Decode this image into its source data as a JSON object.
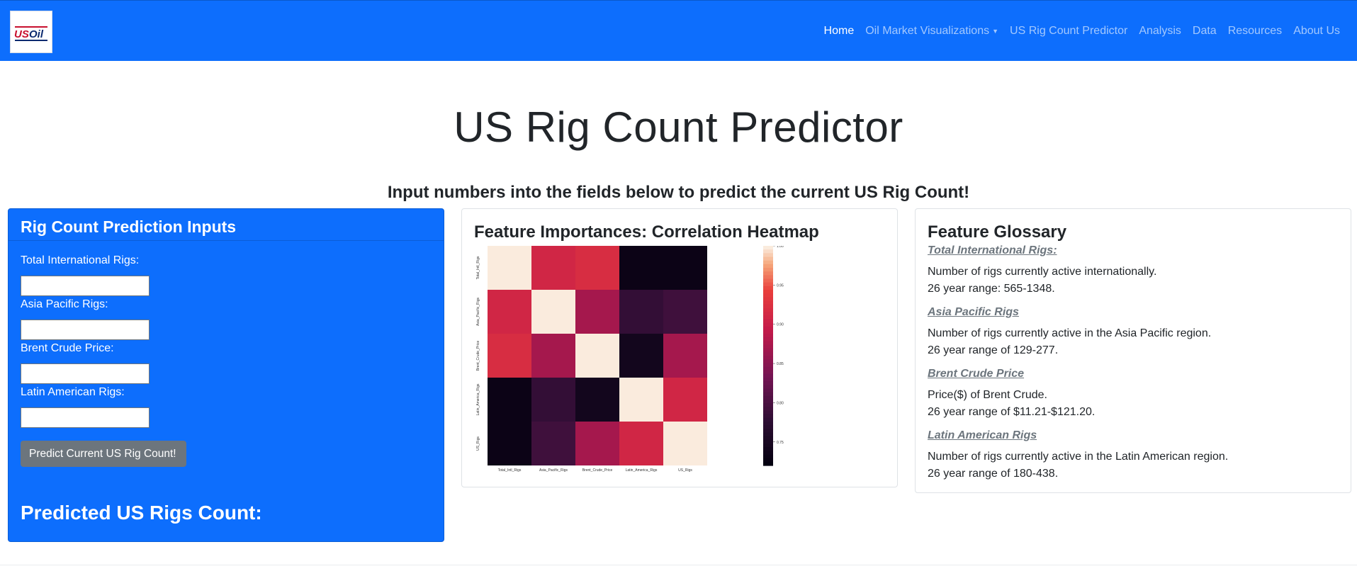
{
  "navbar": {
    "logo_text": "USOil",
    "items": [
      {
        "label": "Home",
        "active": true
      },
      {
        "label": "Oil Market Visualizations",
        "dropdown": true
      },
      {
        "label": "US Rig Count Predictor"
      },
      {
        "label": "Analysis"
      },
      {
        "label": "Data"
      },
      {
        "label": "Resources"
      },
      {
        "label": "About Us"
      }
    ]
  },
  "page": {
    "title": "US Rig Count Predictor",
    "subtitle": "Input numbers into the fields below to predict the current US Rig Count!"
  },
  "inputs_card": {
    "header": "Rig Count Prediction Inputs",
    "fields": [
      {
        "label": "Total International Rigs:",
        "value": ""
      },
      {
        "label": "Asia Pacific Rigs:",
        "value": ""
      },
      {
        "label": "Brent Crude Price:",
        "value": ""
      },
      {
        "label": "Latin American Rigs:",
        "value": ""
      }
    ],
    "button_label": "Predict Current US Rig Count!",
    "prediction_label": "Predicted US Rigs Count:"
  },
  "heatmap_card": {
    "title": "Feature Importances: Correlation Heatmap"
  },
  "glossary_card": {
    "title": "Feature Glossary",
    "entries": [
      {
        "term": "Total International Rigs:",
        "line1": "Number of rigs currently active internationally.",
        "line2": "26 year range: 565-1348."
      },
      {
        "term": "Asia Pacific Rigs",
        "line1": "Number of rigs currently active in the Asia Pacific region.",
        "line2": "26 year range of 129-277."
      },
      {
        "term": "Brent Crude Price",
        "line1": "Price($) of Brent Crude.",
        "line2": "26 year range of $11.21-$121.20."
      },
      {
        "term": "Latin American Rigs",
        "line1": "Number of rigs currently active in the Latin American region.",
        "line2": "26 year range of 180-438."
      }
    ]
  },
  "chart_data": {
    "type": "heatmap",
    "title": "",
    "x_labels": [
      "Total_Intl_Rigs",
      "Asia_Pacific_Rigs",
      "Brent_Crude_Price",
      "Latin_America_Rigs",
      "US_Rigs"
    ],
    "y_labels": [
      "Total_Intl_Rigs",
      "Asia_Pacific_Rigs",
      "Brent_Crude_Price",
      "Latin_America_Rigs",
      "US_Rigs"
    ],
    "values": [
      [
        1.0,
        0.91,
        0.92,
        0.73,
        0.73
      ],
      [
        0.91,
        1.0,
        0.87,
        0.78,
        0.79
      ],
      [
        0.92,
        0.87,
        1.0,
        0.74,
        0.87
      ],
      [
        0.73,
        0.78,
        0.74,
        1.0,
        0.91
      ],
      [
        0.73,
        0.79,
        0.87,
        0.91,
        1.0
      ]
    ],
    "colorbar_ticks": [
      "1.00",
      "0.95",
      "0.90",
      "0.85",
      "0.80",
      "0.75"
    ],
    "vmin": 0.72,
    "vmax": 1.0,
    "colormap": "rocket"
  }
}
